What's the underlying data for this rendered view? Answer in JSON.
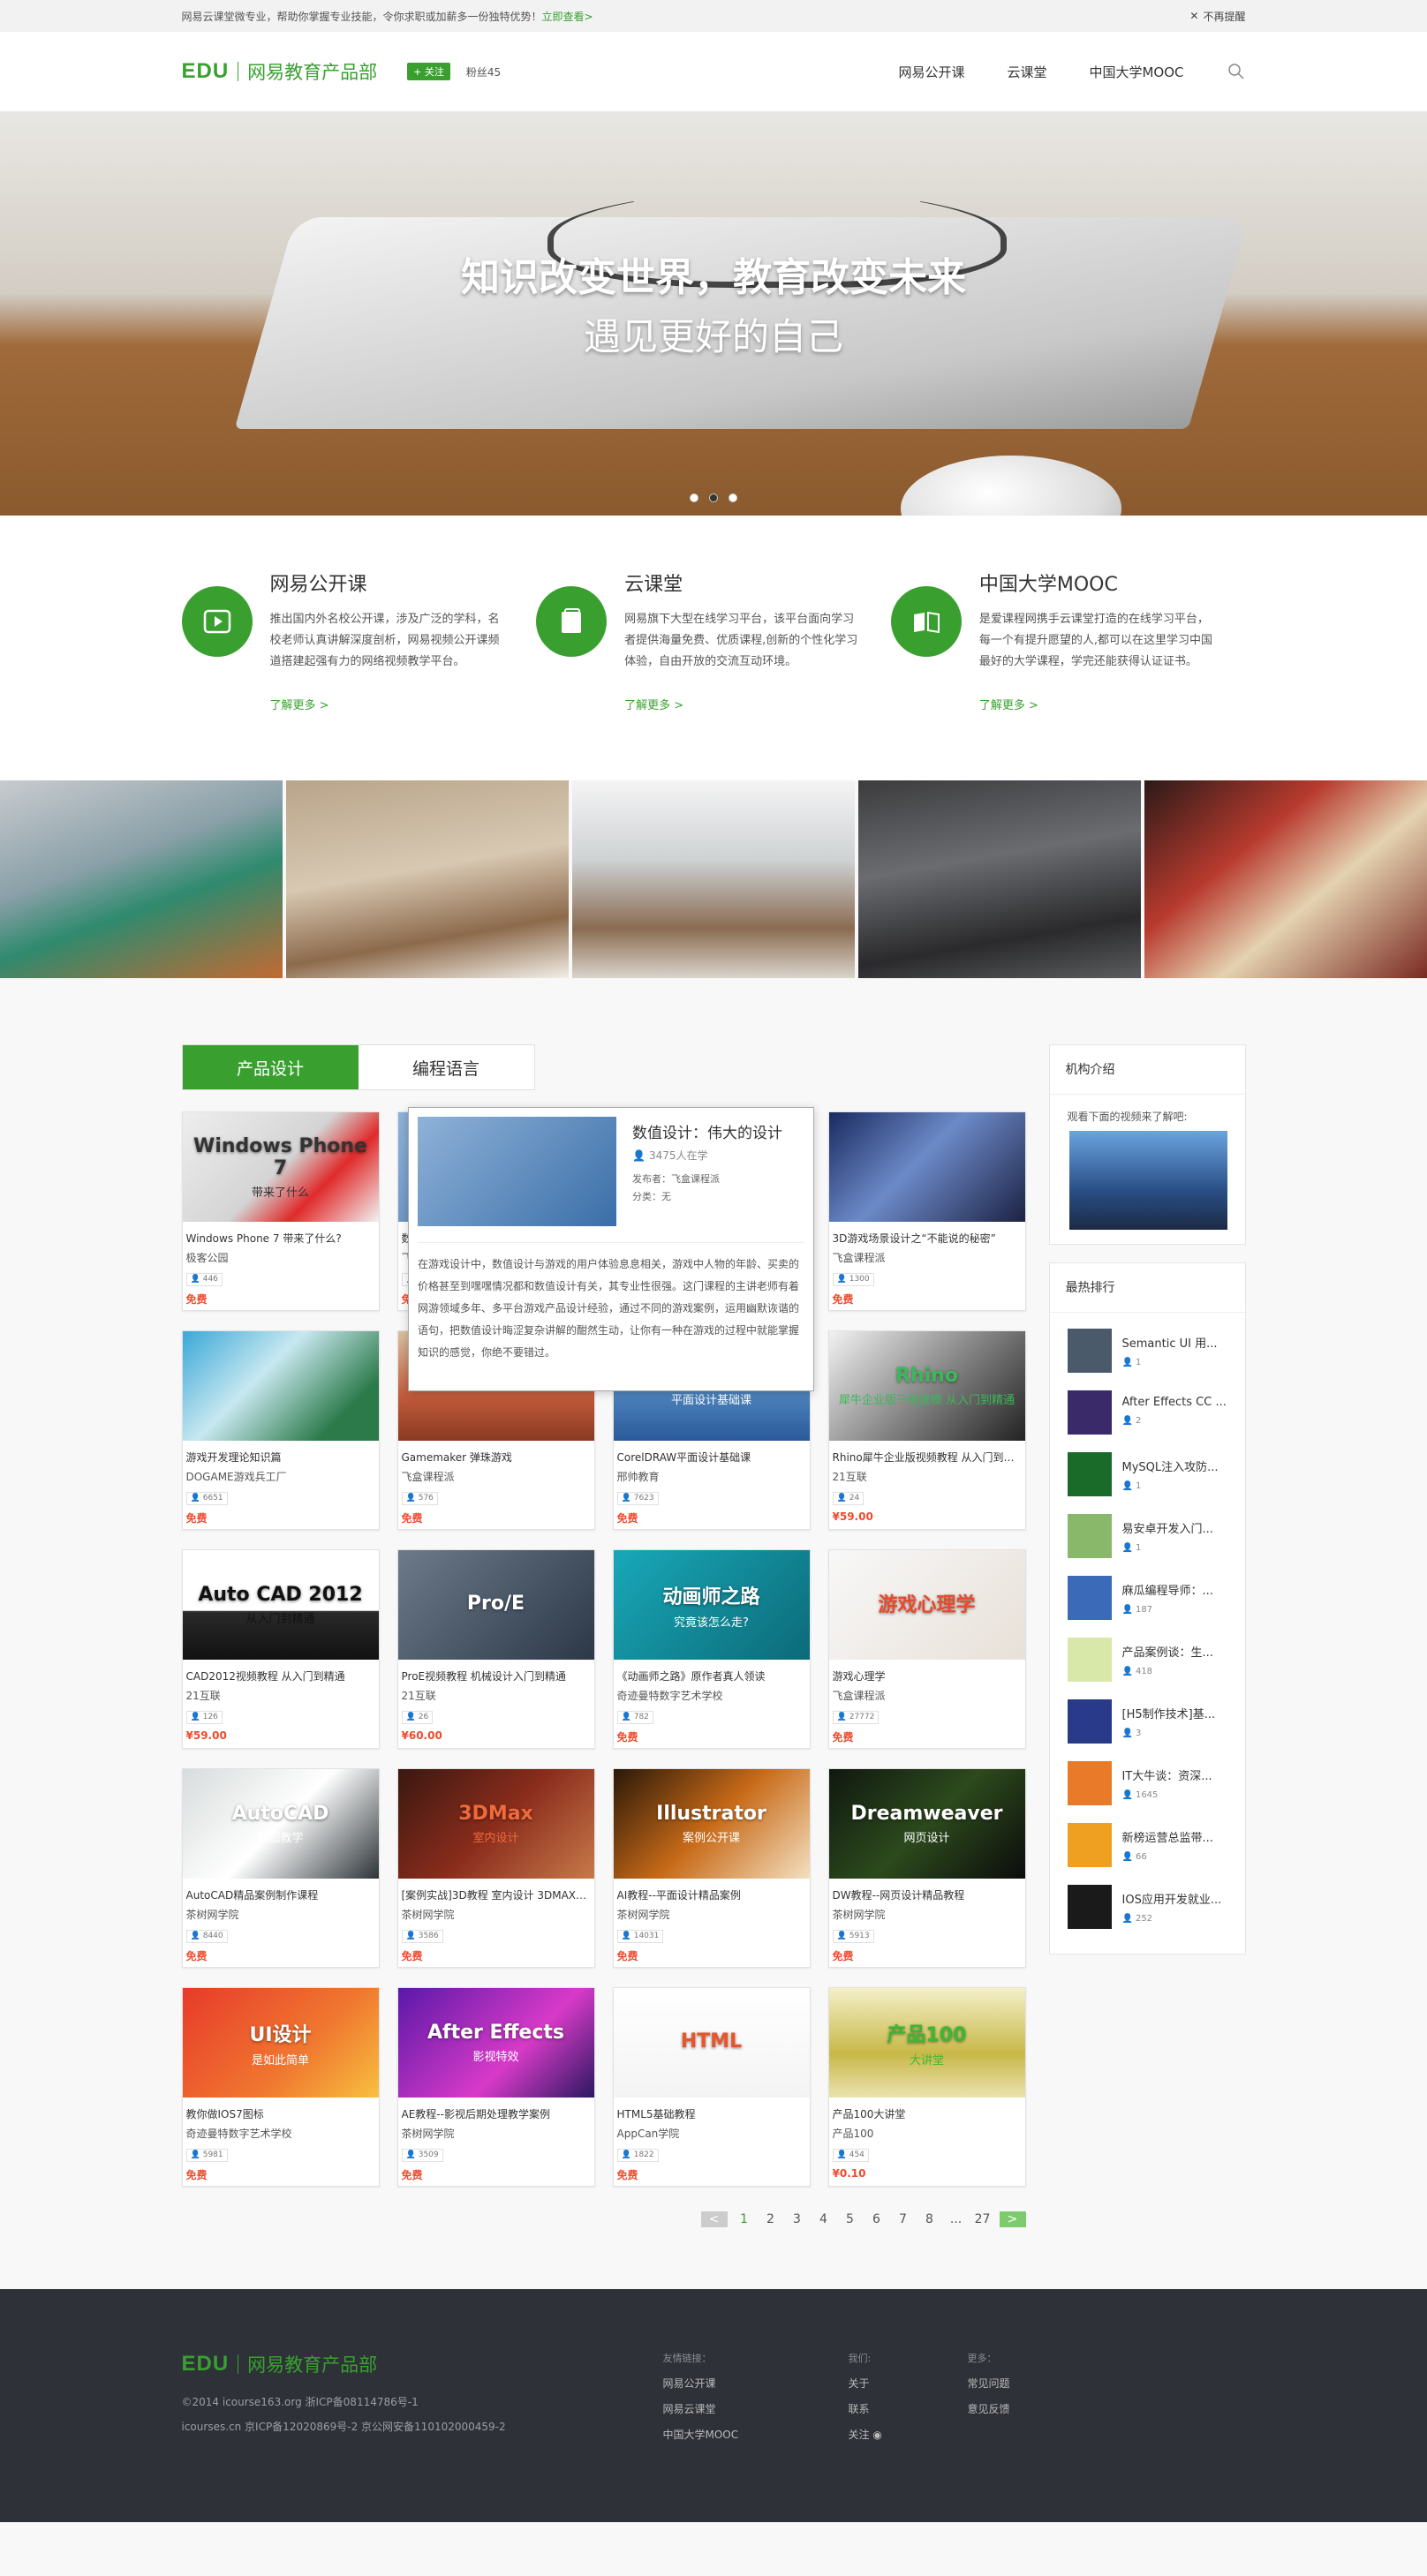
{
  "topbar": {
    "text": "网易云课堂微专业，帮助你掌握专业技能，令你求职或加薪多一份独特优势！",
    "link": "立即查看>",
    "close_label": "不再提醒"
  },
  "header": {
    "logo_edu": "EDU",
    "logo_name": "网易教育产品部",
    "follow_label": "关注",
    "fans": "粉丝45",
    "nav": [
      "网易公开课",
      "云课堂",
      "中国大学MOOC"
    ]
  },
  "banner": {
    "title": "知识改变世界，教育改变未来",
    "subtitle": "遇见更好的自己"
  },
  "intro": [
    {
      "title": "网易公开课",
      "desc": "推出国内外名校公开课，涉及广泛的学科，名校老师认真讲解深度剖析，网易视频公开课频道搭建起强有力的网络视频教学平台。",
      "more": "了解更多 >"
    },
    {
      "title": "云课堂",
      "desc": "网易旗下大型在线学习平台，该平台面向学习者提供海量免费、优质课程,创新的个性化学习体验，自由开放的交流互动环境。",
      "more": "了解更多 >"
    },
    {
      "title": "中国大学MOOC",
      "desc": "是爱课程网携手云课堂打造的在线学习平台，每一个有提升愿望的人,都可以在这里学习中国最好的大学课程，学完还能获得认证证书。",
      "more": "了解更多 >"
    }
  ],
  "tabs": [
    "产品设计",
    "编程语言"
  ],
  "courses": [
    {
      "title": "Windows Phone 7 带来了什么?",
      "org": "极客公园",
      "count": "446",
      "price": "免费",
      "thumb": "Windows Phone 7",
      "thumb_sub": "带来了什么"
    },
    {
      "title": "数值设计：伟大的设计",
      "org": "飞盒课程派",
      "count": "3475",
      "price": "免费",
      "thumb": "",
      "thumb_sub": ""
    },
    {
      "title": "",
      "org": "",
      "count": "",
      "price": "",
      "thumb": "",
      "thumb_sub": ""
    },
    {
      "title": "3D游戏场景设计之“不能说的秘密”",
      "org": "飞盒课程派",
      "count": "1300",
      "price": "免费",
      "thumb": "",
      "thumb_sub": ""
    },
    {
      "title": "游戏开发理论知识篇",
      "org": "DOGAME游戏兵工厂",
      "count": "6651",
      "price": "免费",
      "thumb": "",
      "thumb_sub": ""
    },
    {
      "title": "Gamemaker 弹珠游戏",
      "org": "飞盒课程派",
      "count": "576",
      "price": "免费",
      "thumb": "",
      "thumb_sub": ""
    },
    {
      "title": "CorelDRAW平面设计基础课",
      "org": "邢帅教育",
      "count": "7623",
      "price": "免费",
      "thumb": "CorelDRAW",
      "thumb_sub": "平面设计基础课"
    },
    {
      "title": "Rhino犀牛企业版视频教程 从入门到精通",
      "org": "21互联",
      "count": "24",
      "price": "¥59.00",
      "thumb": "Rhino",
      "thumb_sub": "犀牛企业版三维建模 从入门到精通"
    },
    {
      "title": "CAD2012视频教程 从入门到精通",
      "org": "21互联",
      "count": "126",
      "price": "¥59.00",
      "thumb": "Auto CAD 2012",
      "thumb_sub": "从入门到精通"
    },
    {
      "title": "ProE视频教程 机械设计入门到精通",
      "org": "21互联",
      "count": "26",
      "price": "¥60.00",
      "thumb": "Pro/E",
      "thumb_sub": ""
    },
    {
      "title": "《动画师之路》原作者真人领读",
      "org": "奇迹曼特数字艺术学校",
      "count": "782",
      "price": "免费",
      "thumb": "动画师之路",
      "thumb_sub": "究竟该怎么走?"
    },
    {
      "title": "游戏心理学",
      "org": "飞盒课程派",
      "count": "27772",
      "price": "免费",
      "thumb": "游戏心理学",
      "thumb_sub": ""
    },
    {
      "title": "AutoCAD精品案例制作课程",
      "org": "茶树网学院",
      "count": "8440",
      "price": "免费",
      "thumb": "AutoCAD",
      "thumb_sub": "制图教学"
    },
    {
      "title": "[案例实战]3D教程 室内设计 3DMAX教程",
      "org": "茶树网学院",
      "count": "3586",
      "price": "免费",
      "thumb": "3DMax",
      "thumb_sub": "室内设计"
    },
    {
      "title": "AI教程--平面设计精品案例",
      "org": "茶树网学院",
      "count": "14031",
      "price": "免费",
      "thumb": "Illustrator",
      "thumb_sub": "案例公开课"
    },
    {
      "title": "DW教程--网页设计精品教程",
      "org": "茶树网学院",
      "count": "5913",
      "price": "免费",
      "thumb": "Dreamweaver",
      "thumb_sub": "网页设计"
    },
    {
      "title": "教你做IOS7图标",
      "org": "奇迹曼特数字艺术学校",
      "count": "5981",
      "price": "免费",
      "thumb": "UI设计",
      "thumb_sub": "是如此简单"
    },
    {
      "title": "AE教程--影视后期处理教学案例",
      "org": "茶树网学院",
      "count": "3509",
      "price": "免费",
      "thumb": "After Effects",
      "thumb_sub": "影视特效"
    },
    {
      "title": "HTML5基础教程",
      "org": "AppCan学院",
      "count": "1822",
      "price": "免费",
      "thumb": "HTML",
      "thumb_sub": ""
    },
    {
      "title": "产品100大讲堂",
      "org": "产品100",
      "count": "454",
      "price": "¥0.10",
      "thumb": "产品100",
      "thumb_sub": "大讲堂"
    }
  ],
  "popup": {
    "title": "数值设计：伟大的设计",
    "learners": "3475人在学",
    "publisher": "发布者：飞盒课程派",
    "category": "分类：无",
    "desc": "在游戏设计中，数值设计与游戏的用户体验息息相关，游戏中人物的年龄、买卖的价格甚至到嘿嘿情况都和数值设计有关，其专业性很强。这门课程的主讲老师有着网游领域多年、多平台游戏产品设计经验，通过不同的游戏案例，运用幽默诙谐的语句，把数值设计晦涩复杂讲解的酣然生动，让你有一种在游戏的过程中就能掌握知识的感觉，你绝不要错过。"
  },
  "pager": {
    "pages": [
      "1",
      "2",
      "3",
      "4",
      "5",
      "6",
      "7",
      "8",
      "...",
      "27"
    ],
    "prev": "<",
    "next": ">"
  },
  "side": {
    "org_title": "机构介绍",
    "org_text": "观看下面的视频来了解吧:",
    "rank_title": "最热排行",
    "rank": [
      {
        "title": "Semantic UI 用...",
        "count": "1"
      },
      {
        "title": "After Effects CC ...",
        "count": "2"
      },
      {
        "title": "MySQL注入攻防...",
        "count": "1"
      },
      {
        "title": "易安卓开发入门...",
        "count": "1"
      },
      {
        "title": "麻瓜编程导师：...",
        "count": "187"
      },
      {
        "title": "产品案例谈：生...",
        "count": "418"
      },
      {
        "title": "[H5制作技术]基...",
        "count": "3"
      },
      {
        "title": "IT大牛谈：资深...",
        "count": "1645"
      },
      {
        "title": "新榜运营总监带...",
        "count": "66"
      },
      {
        "title": "IOS应用开发就业...",
        "count": "252"
      }
    ]
  },
  "footer": {
    "logo_edu": "EDU",
    "logo_name": "网易教育产品部",
    "copy1": "©2014 icourse163.org 浙ICP备08114786号-1",
    "copy2": "icourses.cn 京ICP备12020869号-2 京公网安备110102000459-2",
    "links_title": "友情链接：",
    "links": [
      "网易公开课",
      "网易云课堂",
      "中国大学MOOC"
    ],
    "we_title": "我们:",
    "we": [
      "关于",
      "联系",
      "关注"
    ],
    "more_title": "更多：",
    "more": [
      "常见问题",
      "意见反馈"
    ]
  },
  "colors": {
    "brand": "#39a030",
    "price": "#f04a2c",
    "footer_bg": "#2e3138"
  }
}
